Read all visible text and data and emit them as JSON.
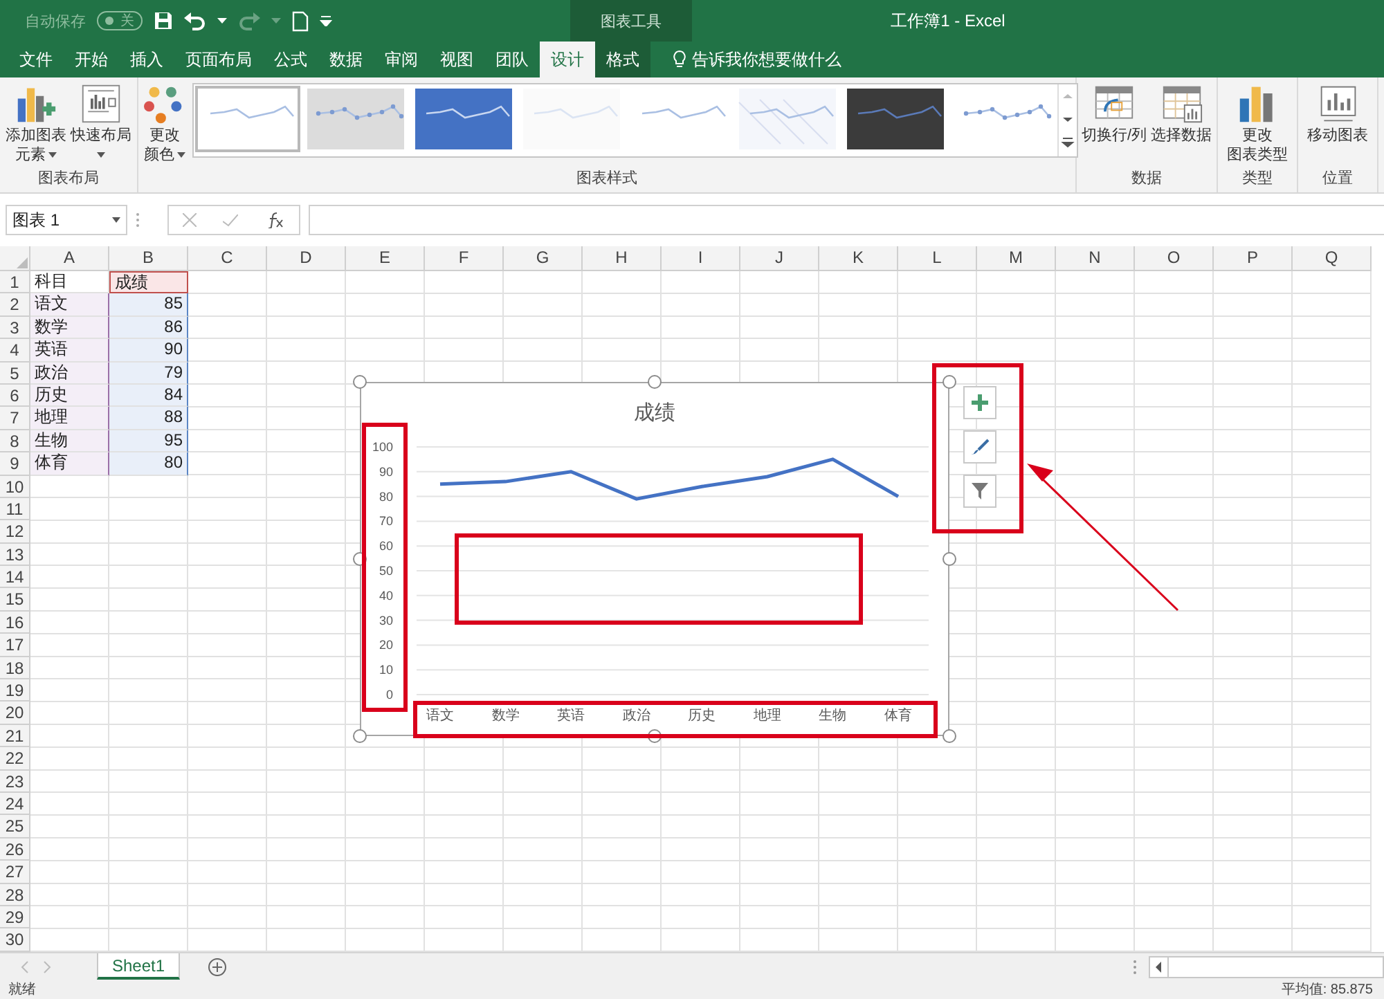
{
  "title_bar": {
    "autosave": {
      "label": "自动保存",
      "state": "关",
      "on": false
    },
    "context_tab": "图表工具",
    "title": "工作簿1  -  Excel"
  },
  "tabs": [
    {
      "label": "文件",
      "selected": false,
      "contextual": false
    },
    {
      "label": "开始",
      "selected": false,
      "contextual": false
    },
    {
      "label": "插入",
      "selected": false,
      "contextual": false
    },
    {
      "label": "页面布局",
      "selected": false,
      "contextual": false
    },
    {
      "label": "公式",
      "selected": false,
      "contextual": false
    },
    {
      "label": "数据",
      "selected": false,
      "contextual": false
    },
    {
      "label": "审阅",
      "selected": false,
      "contextual": false
    },
    {
      "label": "视图",
      "selected": false,
      "contextual": false
    },
    {
      "label": "团队",
      "selected": false,
      "contextual": false
    },
    {
      "label": "设计",
      "selected": true,
      "contextual": true
    },
    {
      "label": "格式",
      "selected": false,
      "contextual": true
    }
  ],
  "tell_me": "告诉我你想要做什么",
  "ribbon": {
    "groups": [
      {
        "label": "图表布局",
        "buttons": [
          {
            "kind": "add-element",
            "lines": [
              "添加图表",
              "元素"
            ],
            "dropdown": true
          },
          {
            "kind": "quick-layout",
            "lines": [
              "快速布局"
            ],
            "dropdown": true
          }
        ]
      },
      {
        "label": "图表样式",
        "buttons": [
          {
            "kind": "colors",
            "lines": [
              "更改",
              "颜色"
            ],
            "dropdown": true
          }
        ],
        "gallery": [
          {
            "kind": "plain",
            "selected": true
          },
          {
            "kind": "markers-grey",
            "selected": false
          },
          {
            "kind": "blue",
            "selected": false
          },
          {
            "kind": "faint",
            "selected": false
          },
          {
            "kind": "plain",
            "selected": false
          },
          {
            "kind": "hatched",
            "selected": false
          },
          {
            "kind": "dark",
            "selected": false
          },
          {
            "kind": "markers",
            "selected": false
          }
        ]
      },
      {
        "label": "数据",
        "buttons": [
          {
            "kind": "switch",
            "lines": [
              "切换行/列"
            ],
            "dropdown": false
          },
          {
            "kind": "select-data",
            "lines": [
              "选择数据"
            ],
            "dropdown": false
          }
        ]
      },
      {
        "label": "类型",
        "buttons": [
          {
            "kind": "chart-type",
            "lines": [
              "更改",
              "图表类型"
            ],
            "dropdown": false
          }
        ]
      },
      {
        "label": "位置",
        "buttons": [
          {
            "kind": "move-chart",
            "lines": [
              "移动图表"
            ],
            "dropdown": false
          }
        ]
      }
    ]
  },
  "formula_bar": {
    "name_box": "图表 1"
  },
  "sheet": {
    "columns": [
      "A",
      "B",
      "C",
      "D",
      "E",
      "F",
      "G",
      "H",
      "I",
      "J",
      "K",
      "L",
      "M",
      "N",
      "O",
      "P",
      "Q"
    ],
    "rows": [
      {
        "number": "1",
        "cells": [
          {
            "text": "科目",
            "kind": "plain"
          },
          {
            "text": "成绩",
            "kind": "series"
          }
        ]
      },
      {
        "number": "2",
        "cells": [
          {
            "text": "语文",
            "kind": "category"
          },
          {
            "text": "85",
            "kind": "value"
          }
        ]
      },
      {
        "number": "3",
        "cells": [
          {
            "text": "数学",
            "kind": "category"
          },
          {
            "text": "86",
            "kind": "value"
          }
        ]
      },
      {
        "number": "4",
        "cells": [
          {
            "text": "英语",
            "kind": "category"
          },
          {
            "text": "90",
            "kind": "value"
          }
        ]
      },
      {
        "number": "5",
        "cells": [
          {
            "text": "政治",
            "kind": "category"
          },
          {
            "text": "79",
            "kind": "value"
          }
        ]
      },
      {
        "number": "6",
        "cells": [
          {
            "text": "历史",
            "kind": "category"
          },
          {
            "text": "84",
            "kind": "value"
          }
        ]
      },
      {
        "number": "7",
        "cells": [
          {
            "text": "地理",
            "kind": "category"
          },
          {
            "text": "88",
            "kind": "value"
          }
        ]
      },
      {
        "number": "8",
        "cells": [
          {
            "text": "生物",
            "kind": "category"
          },
          {
            "text": "95",
            "kind": "value"
          }
        ]
      },
      {
        "number": "9",
        "cells": [
          {
            "text": "体育",
            "kind": "category"
          },
          {
            "text": "80",
            "kind": "value"
          }
        ]
      },
      {
        "number": "10"
      },
      {
        "number": "11"
      },
      {
        "number": "12"
      },
      {
        "number": "13"
      },
      {
        "number": "14"
      },
      {
        "number": "15"
      },
      {
        "number": "16"
      },
      {
        "number": "17"
      },
      {
        "number": "18"
      },
      {
        "number": "19"
      },
      {
        "number": "20"
      },
      {
        "number": "21"
      },
      {
        "number": "22"
      },
      {
        "number": "23"
      },
      {
        "number": "24"
      },
      {
        "number": "25"
      },
      {
        "number": "26"
      },
      {
        "number": "27"
      },
      {
        "number": "28"
      },
      {
        "number": "29"
      },
      {
        "number": "30"
      }
    ]
  },
  "chart": {
    "chart_data": {
      "type": "line",
      "title": "成绩",
      "categories": [
        "语文",
        "数学",
        "英语",
        "政治",
        "历史",
        "地理",
        "生物",
        "体育"
      ],
      "series": [
        {
          "color": "#4472c4",
          "values": [
            85,
            86,
            90,
            79,
            84,
            88,
            95,
            80
          ]
        }
      ],
      "ylim": [
        0,
        100
      ],
      "yticks": [
        0,
        10,
        20,
        30,
        40,
        50,
        60,
        70,
        80,
        90,
        100
      ],
      "grid": true
    },
    "buttons": [
      {
        "kind": "elements"
      },
      {
        "kind": "styles"
      },
      {
        "kind": "filter"
      }
    ]
  },
  "sheet_tabs": [
    {
      "label": "Sheet1",
      "selected": true
    }
  ],
  "status_bar": {
    "status": "就绪",
    "average": "平均值: 85.875"
  }
}
